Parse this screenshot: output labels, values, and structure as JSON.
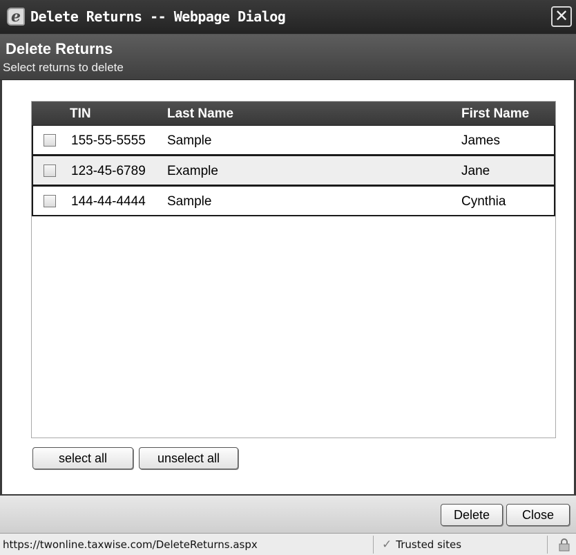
{
  "window": {
    "title": "Delete Returns -- Webpage Dialog",
    "close_glyph": "✕",
    "icon": "ie-icon"
  },
  "header": {
    "title": "Delete Returns",
    "subtitle": "Select returns to delete"
  },
  "table": {
    "columns": [
      "TIN",
      "Last Name",
      "First Name"
    ],
    "rows": [
      {
        "tin": "155-55-5555",
        "last": "Sample",
        "first": "James",
        "checked": false
      },
      {
        "tin": "123-45-6789",
        "last": "Example",
        "first": "Jane",
        "checked": false
      },
      {
        "tin": "144-44-4444",
        "last": "Sample",
        "first": "Cynthia",
        "checked": false
      }
    ]
  },
  "buttons": {
    "select_all": "select all",
    "unselect_all": "unselect all",
    "delete": "Delete",
    "close": "Close"
  },
  "statusbar": {
    "url": "https://twonline.taxwise.com/DeleteReturns.aspx",
    "zone": "Trusted sites",
    "zone_icon": "check-icon",
    "security_icon": "lock-icon"
  }
}
